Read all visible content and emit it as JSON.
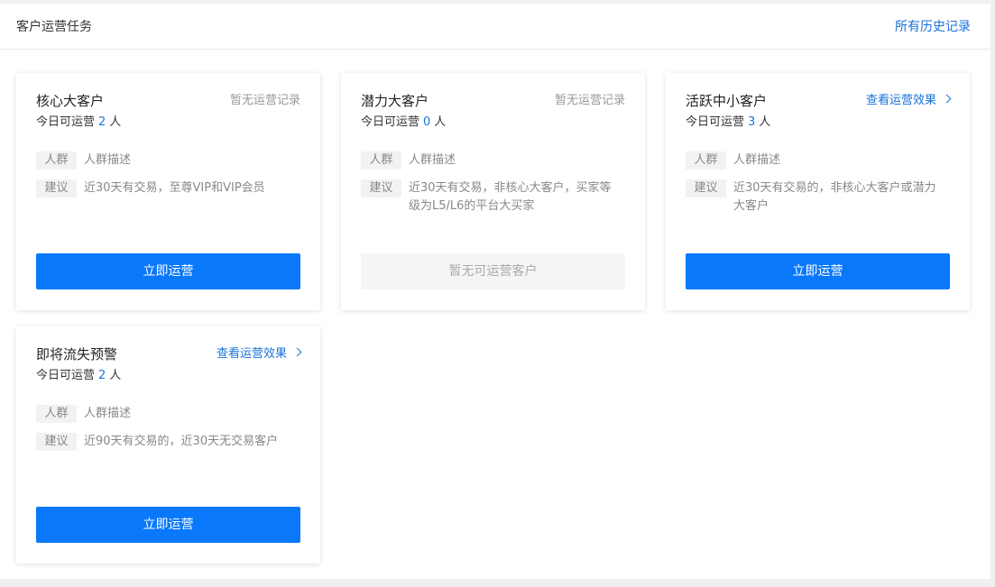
{
  "header": {
    "title": "客户运营任务",
    "history_link": "所有历史记录"
  },
  "cards": [
    {
      "title": "核心大客户",
      "status": "暂无运营记录",
      "count_prefix": "今日可运营",
      "count": "2",
      "count_suffix": "人",
      "tag1_label": "人群",
      "tag1_text": "人群描述",
      "tag2_label": "建议",
      "tag2_text": "近30天有交易，至尊VIP和VIP会员",
      "button": "立即运营"
    },
    {
      "title": "潜力大客户",
      "status": "暂无运营记录",
      "count_prefix": "今日可运营",
      "count": "0",
      "count_suffix": "人",
      "tag1_label": "人群",
      "tag1_text": "人群描述",
      "tag2_label": "建议",
      "tag2_text": "近30天有交易，非核心大客户，买家等级为L5/L6的平台大买家",
      "button": "暂无可运营客户"
    },
    {
      "title": "活跃中小客户",
      "status": "查看运营效果",
      "count_prefix": "今日可运营",
      "count": "3",
      "count_suffix": "人",
      "tag1_label": "人群",
      "tag1_text": "人群描述",
      "tag2_label": "建议",
      "tag2_text": "近30天有交易的，非核心大客户或潜力大客户",
      "button": "立即运营"
    },
    {
      "title": "即将流失预警",
      "status": "查看运营效果",
      "count_prefix": "今日可运营",
      "count": "2",
      "count_suffix": "人",
      "tag1_label": "人群",
      "tag1_text": "人群描述",
      "tag2_label": "建议",
      "tag2_text": "近90天有交易的，近30天无交易客户",
      "button": "立即运营"
    }
  ],
  "colors": {
    "accent": "#0a78fa",
    "link": "#1a73d9",
    "muted": "#999999",
    "tag_bg": "#f2f2f2"
  },
  "icons": {
    "status_link_icon": "chevron-right-icon"
  }
}
